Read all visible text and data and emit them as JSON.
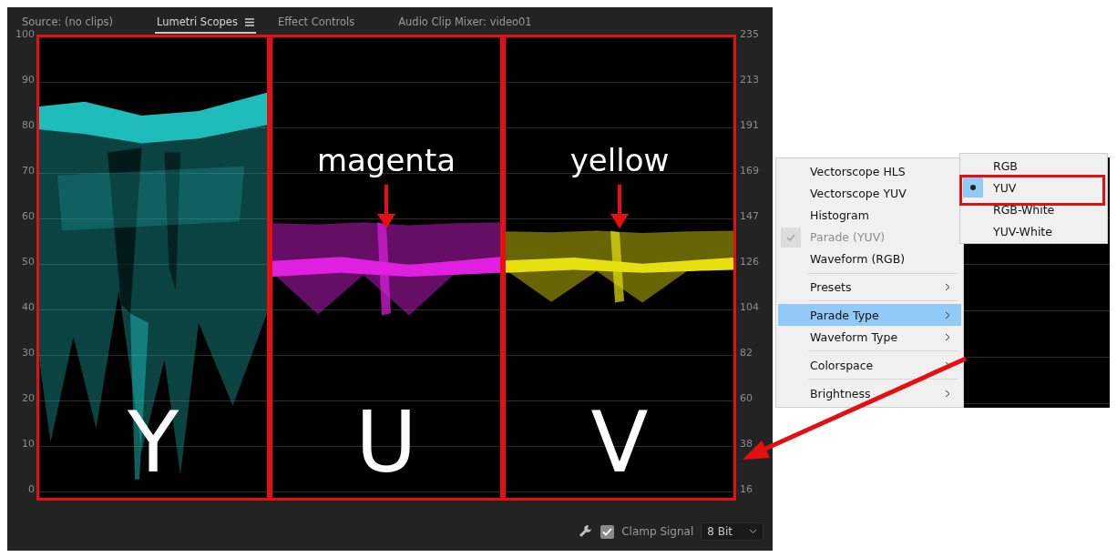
{
  "tabs": [
    {
      "label": "Source: (no clips)",
      "selected": false,
      "menu": false
    },
    {
      "label": "Lumetri Scopes",
      "selected": true,
      "menu": true
    },
    {
      "label": "Effect Controls",
      "selected": false,
      "menu": false
    },
    {
      "label": "Audio Clip Mixer: video01",
      "selected": false,
      "menu": false
    }
  ],
  "scope": {
    "left_ticks": [
      "100",
      "90",
      "80",
      "70",
      "60",
      "50",
      "40",
      "30",
      "20",
      "10",
      "0"
    ],
    "right_ticks": [
      "235",
      "213",
      "191",
      "169",
      "147",
      "126",
      "104",
      "82",
      "60",
      "38",
      "16"
    ],
    "channels": [
      {
        "label": "Y",
        "color": "#1fbcbc",
        "kind": "luma"
      },
      {
        "label": "U",
        "color": "#e020e0",
        "kind": "band",
        "annotation": "magenta"
      },
      {
        "label": "V",
        "color": "#e6e010",
        "kind": "band",
        "annotation": "yellow"
      }
    ]
  },
  "footer": {
    "clamp_label": "Clamp Signal",
    "clamp_checked": true,
    "bit_depth": "8 Bit"
  },
  "menu": {
    "items": [
      {
        "kind": "item",
        "label": "Vectorscope HLS",
        "selected": false,
        "checked": false,
        "disabled": false,
        "submenu": false
      },
      {
        "kind": "item",
        "label": "Vectorscope YUV",
        "selected": false,
        "checked": false,
        "disabled": false,
        "submenu": false
      },
      {
        "kind": "item",
        "label": "Histogram",
        "selected": false,
        "checked": false,
        "disabled": false,
        "submenu": false
      },
      {
        "kind": "item",
        "label": "Parade (YUV)",
        "selected": false,
        "checked": true,
        "disabled": true,
        "submenu": false
      },
      {
        "kind": "item",
        "label": "Waveform (RGB)",
        "selected": false,
        "checked": false,
        "disabled": false,
        "submenu": false
      },
      {
        "kind": "separator"
      },
      {
        "kind": "item",
        "label": "Presets",
        "selected": false,
        "checked": false,
        "disabled": false,
        "submenu": true
      },
      {
        "kind": "separator"
      },
      {
        "kind": "item",
        "label": "Parade Type",
        "selected": true,
        "checked": false,
        "disabled": false,
        "submenu": true
      },
      {
        "kind": "item",
        "label": "Waveform Type",
        "selected": false,
        "checked": false,
        "disabled": false,
        "submenu": true
      },
      {
        "kind": "separator"
      },
      {
        "kind": "item",
        "label": "Colorspace",
        "selected": false,
        "checked": false,
        "disabled": false,
        "submenu": true
      },
      {
        "kind": "separator"
      },
      {
        "kind": "item",
        "label": "Brightness",
        "selected": false,
        "checked": false,
        "disabled": false,
        "submenu": true
      }
    ],
    "submenu": [
      {
        "label": "RGB",
        "selected": false
      },
      {
        "label": "YUV",
        "selected": true
      },
      {
        "label": "RGB-White",
        "selected": false
      },
      {
        "label": "YUV-White",
        "selected": false
      }
    ]
  }
}
